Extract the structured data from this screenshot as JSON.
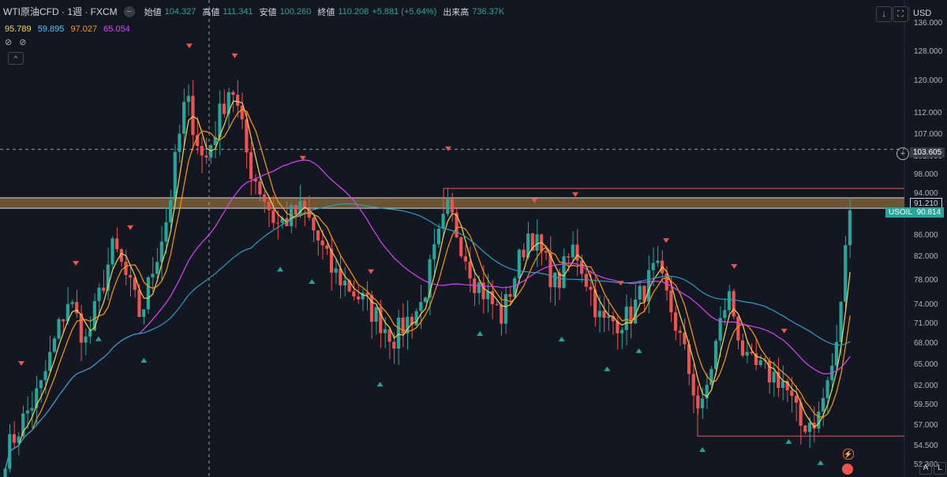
{
  "header": {
    "symbol": "WTI原油CFD · 1週 · FXCM",
    "eye_icon": "eye-icon",
    "open_label": "始値",
    "open_value": "104.327",
    "high_label": "高値",
    "high_value": "111.341",
    "low_label": "安値",
    "low_value": "100.260",
    "close_label": "終値",
    "close_value": "110.208",
    "change": "+5.881 (+5.64%)",
    "volume_label": "出来高",
    "volume_value": "736.37K"
  },
  "ma_values": [
    {
      "value": "95.789",
      "color": "#f5d547"
    },
    {
      "value": "59.895",
      "color": "#4fc3f7"
    },
    {
      "value": "97.027",
      "color": "#ff9800"
    },
    {
      "value": "65.054",
      "color": "#e040fb"
    }
  ],
  "tools": {
    "icon_a": "⊘",
    "icon_b": "⊘"
  },
  "currency": "USD",
  "axis": {
    "ticks": [
      "136.000",
      "128.000",
      "120.000",
      "112.000",
      "107.000",
      "102.000",
      "98.000",
      "94.000",
      "86.000",
      "82.000",
      "78.000",
      "74.000",
      "71.000",
      "68.000",
      "65.000",
      "62.000",
      "59.500",
      "57.000",
      "54.500",
      "52.300"
    ]
  },
  "crosshair_price": "103.605",
  "hline_price": "91.210",
  "current_tag": {
    "name": "USOIL",
    "price": "90.814"
  },
  "bottom_buttons": {
    "auto": "A",
    "log": "L"
  },
  "colors": {
    "up": "#26a69a",
    "down": "#ef5350",
    "ma_yellow": "#f5d547",
    "ma_orange": "#ff9800",
    "ma_magenta": "#e040fb",
    "ma_cyan": "#26a0b8",
    "zone": "#8b6a3a"
  },
  "chart_data": {
    "type": "candlestick",
    "y_axis_scale": "log",
    "ylim": [
      52.3,
      136
    ],
    "resistance_zone": [
      91.2,
      93.3
    ],
    "resistance_line": 95.2,
    "support_line": 55.7,
    "anchors": [
      {
        "x": 0,
        "price": 53.5
      },
      {
        "x": 0.04,
        "price": 62
      },
      {
        "x": 0.07,
        "price": 75
      },
      {
        "x": 0.09,
        "price": 68
      },
      {
        "x": 0.12,
        "price": 84
      },
      {
        "x": 0.15,
        "price": 72
      },
      {
        "x": 0.18,
        "price": 90
      },
      {
        "x": 0.2,
        "price": 116
      },
      {
        "x": 0.22,
        "price": 100
      },
      {
        "x": 0.25,
        "price": 120
      },
      {
        "x": 0.27,
        "price": 100
      },
      {
        "x": 0.3,
        "price": 88
      },
      {
        "x": 0.33,
        "price": 91
      },
      {
        "x": 0.36,
        "price": 80
      },
      {
        "x": 0.4,
        "price": 74
      },
      {
        "x": 0.43,
        "price": 69
      },
      {
        "x": 0.46,
        "price": 74
      },
      {
        "x": 0.49,
        "price": 91
      },
      {
        "x": 0.52,
        "price": 78
      },
      {
        "x": 0.55,
        "price": 72
      },
      {
        "x": 0.58,
        "price": 87
      },
      {
        "x": 0.61,
        "price": 77
      },
      {
        "x": 0.63,
        "price": 84
      },
      {
        "x": 0.66,
        "price": 71
      },
      {
        "x": 0.69,
        "price": 72
      },
      {
        "x": 0.72,
        "price": 80
      },
      {
        "x": 0.74,
        "price": 72
      },
      {
        "x": 0.77,
        "price": 58
      },
      {
        "x": 0.8,
        "price": 76
      },
      {
        "x": 0.82,
        "price": 65
      },
      {
        "x": 0.86,
        "price": 63
      },
      {
        "x": 0.88,
        "price": 57
      },
      {
        "x": 0.9,
        "price": 58
      },
      {
        "x": 0.92,
        "price": 67
      },
      {
        "x": 0.935,
        "price": 90.8
      }
    ],
    "ma_series": [
      {
        "color": "#f5d547",
        "lag": 3
      },
      {
        "color": "#ff9800",
        "lag": 6
      },
      {
        "color": "#e040fb",
        "lag": 30
      },
      {
        "color": "#26a0b8",
        "lag": 55
      }
    ],
    "markers_down": [
      0.02,
      0.08,
      0.14,
      0.205,
      0.255,
      0.33,
      0.405,
      0.49,
      0.585,
      0.63,
      0.68,
      0.73,
      0.805,
      0.86
    ],
    "markers_up": [
      0.105,
      0.155,
      0.305,
      0.34,
      0.415,
      0.525,
      0.615,
      0.665,
      0.7,
      0.77,
      0.865,
      0.9
    ]
  }
}
